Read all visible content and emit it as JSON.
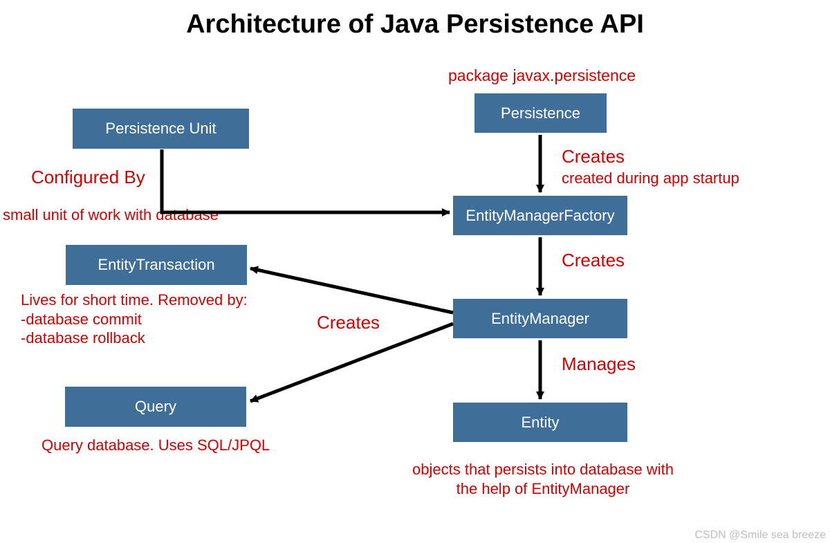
{
  "title": "Architecture of Java Persistence API",
  "boxes": {
    "persistence_unit": "Persistence Unit",
    "entity_transaction": "EntityTransaction",
    "query": "Query",
    "persistence": "Persistence",
    "entity_manager_factory": "EntityManagerFactory",
    "entity_manager": "EntityManager",
    "entity": "Entity"
  },
  "labels": {
    "package": "package javax.persistence",
    "creates1": "Creates",
    "created_startup": "created during app startup",
    "configured_by": "Configured By",
    "small_unit": "small unit of work with database",
    "creates2": "Creates",
    "transaction_note_l1": "Lives for short time. Removed by:",
    "transaction_note_l2": "-database commit",
    "transaction_note_l3": "-database rollback",
    "creates3": "Creates",
    "manages": "Manages",
    "query_note": "Query database. Uses SQL/JPQL",
    "entity_note_l1": "objects that persists into database with",
    "entity_note_l2": "the help of EntityManager"
  },
  "watermark": "CSDN @Smile sea breeze"
}
